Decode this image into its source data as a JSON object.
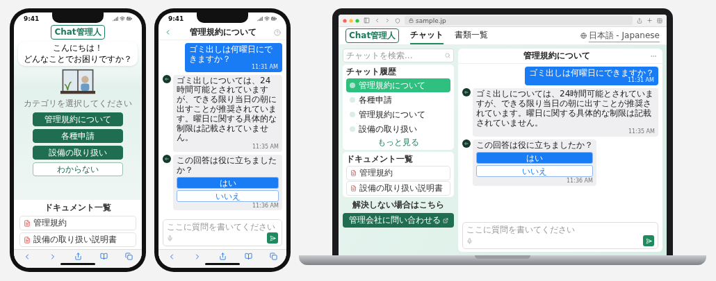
{
  "phone_home": {
    "status_time": "9:41",
    "logo": "Chat管理人",
    "greeting": [
      "こんにちは！",
      "どんなことでお困りですか？"
    ],
    "prompt": "カテゴリを選択してください",
    "categories": [
      {
        "label": "管理規約について",
        "kind": "filled"
      },
      {
        "label": "各種申請",
        "kind": "filled"
      },
      {
        "label": "設備の取り扱い",
        "kind": "filled"
      },
      {
        "label": "わからない",
        "kind": "outline"
      }
    ],
    "documents_title": "ドキュメント一覧",
    "documents": [
      "管理規約",
      "設備の取り扱い説明書"
    ]
  },
  "phone_chat": {
    "status_time": "9:41",
    "title": "管理規約について",
    "messages": [
      {
        "kind": "user",
        "text": "ゴミ出しは何曜日にできますか？",
        "time": "11:31 AM"
      },
      {
        "kind": "bot",
        "text": "ゴミ出しについては、24時間可能とされていますが、できる限り当日の朝に出すことが推奨されています。曜日に関する具体的な制限は記載されていません。",
        "time": "11:35 AM"
      },
      {
        "kind": "feedback",
        "question": "この回答は役に立ちましたか？",
        "yes": "はい",
        "no": "いいえ",
        "time": "11:36 AM"
      }
    ],
    "input": {
      "placeholder": "ここに質問を書いてください"
    }
  },
  "laptop": {
    "url": "sample.jp",
    "logo": "Chat管理人",
    "tabs": [
      {
        "label": "チャット",
        "selected": true
      },
      {
        "label": "書類一覧",
        "selected": false
      }
    ],
    "language": "日本語 - Japanese",
    "search": {
      "placeholder": "チャットを検索..."
    },
    "history_title": "チャット履歴",
    "history": [
      {
        "label": "管理規約について",
        "selected": true
      },
      {
        "label": "各種申請",
        "selected": false
      },
      {
        "label": "管理規約について",
        "selected": false
      },
      {
        "label": "設備の取り扱い",
        "selected": false
      }
    ],
    "more_link": "もっと見る",
    "documents_title": "ドキュメント一覧",
    "documents": [
      "管理規約",
      "設備の取り扱い説明書"
    ],
    "help_text": "解決しない場合はこちら",
    "contact_button": "管理会社に問い合わせる",
    "chat": {
      "title": "管理規約について",
      "messages": [
        {
          "kind": "user",
          "text": "ゴミ出しは何曜日にできますか？",
          "time": "11:31 AM"
        },
        {
          "kind": "bot",
          "text": "ゴミ出しについては、24時間可能とされていますが、できる限り当日の朝に出すことが推奨されています。曜日に関する具体的な制限は記載されていません。",
          "time": "11:35 AM"
        },
        {
          "kind": "feedback",
          "question": "この回答は役に立ちましたか？",
          "yes": "はい",
          "no": "いいえ",
          "time": "11:36 AM"
        }
      ],
      "input": {
        "placeholder": "ここに質問を書いてください"
      }
    }
  }
}
